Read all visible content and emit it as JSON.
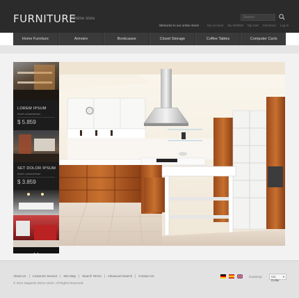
{
  "header": {
    "logo": "FURNITURE",
    "slogan": "Online store",
    "search_placeholder": "Search",
    "welcome": "Welcome to our online store!",
    "top_links": [
      "My Account",
      "My Wishlist",
      "My Cart",
      "Checkout",
      "Log In"
    ]
  },
  "nav": {
    "items": [
      "Home Furniture",
      "Armoire",
      "Bookcases",
      "Closet Storage",
      "Coffee Tables",
      "Computer Carts"
    ]
  },
  "slider": {
    "items": [
      {
        "title": "LOREM IPSUM",
        "subtitle": "Amet consectetuer",
        "price": "$ 5.859"
      },
      {
        "title": "SET DOLOR IPSUM",
        "subtitle": "Amet consectetuer",
        "price": "$ 3.859"
      }
    ]
  },
  "footer": {
    "links": [
      "About Us",
      "Customer Service",
      "Site Map",
      "Search Terms",
      "Advanced Search",
      "Contact Us"
    ],
    "copyright": "© 2012 Magento Demo Store. All Rights Reserved.",
    "currency_label": "Currency:",
    "currency_value": "US Dollar"
  },
  "colors": {
    "header_bg": "#2b2b2b",
    "nav_bg": "#3a3a3a",
    "footer_bg": "#e2e2e2"
  }
}
